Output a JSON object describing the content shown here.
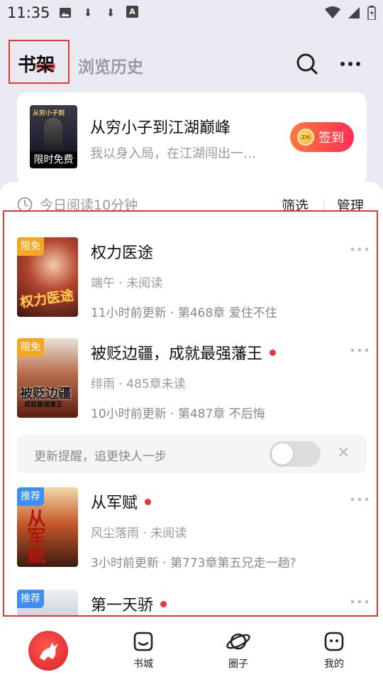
{
  "status_bar": {
    "time": "11:35",
    "download_glyph": "⬇",
    "a_glyph": "A",
    "left_icons": [
      "image-icon",
      "download-icon",
      "download-icon",
      "a-badge-icon"
    ],
    "right_icons": [
      "wifi-icon",
      "signal-icon",
      "battery-icon"
    ]
  },
  "header": {
    "tab_bookshelf": "书架",
    "tab_history": "浏览历史",
    "icons": [
      "search-icon",
      "more-icon"
    ]
  },
  "promo": {
    "title": "从穷小子到江湖巅峰",
    "desc": "我以身入局，在江湖闯出一…",
    "cover_title": "从穷小子到",
    "free_label": "限时免费",
    "signin_label": "签到",
    "coin_text": "ZH"
  },
  "reading": {
    "text": "今日阅读10分钟",
    "filter": "筛选",
    "manage": "管理"
  },
  "books": [
    {
      "badge": "限免",
      "cover_text": "权力医途",
      "title": "权力医途",
      "new_dot": false,
      "meta": "端午 · 未阅读",
      "update": "11小时前更新 · 第468章 爱住不住"
    },
    {
      "badge": "限免",
      "cover_text": "被贬边疆",
      "cover_subtext": "成就最强藩王",
      "title": "被贬边疆，成就最强藩王",
      "new_dot": true,
      "meta": "绯雨 · 485章未读",
      "update": "10小时前更新 · 第487章 不后悔"
    },
    {
      "badge": "推荐",
      "cover_text": "从军赋",
      "title": "从军赋",
      "new_dot": true,
      "meta": "风尘落雨 · 未阅读",
      "update": "3小时前更新 · 第773章第五兄走一趟?"
    },
    {
      "badge": "推荐",
      "title": "第一天骄",
      "new_dot": true
    }
  ],
  "reminder": {
    "text": "更新提醒，追更快人一步",
    "close": "✕",
    "enabled": false
  },
  "nav": {
    "items": [
      {
        "label": "书城",
        "icon": "bookstore-icon"
      },
      {
        "label": "圈子",
        "icon": "planet-icon"
      },
      {
        "label": "我的",
        "icon": "profile-icon"
      }
    ],
    "home_icon": "deer-logo-icon"
  }
}
